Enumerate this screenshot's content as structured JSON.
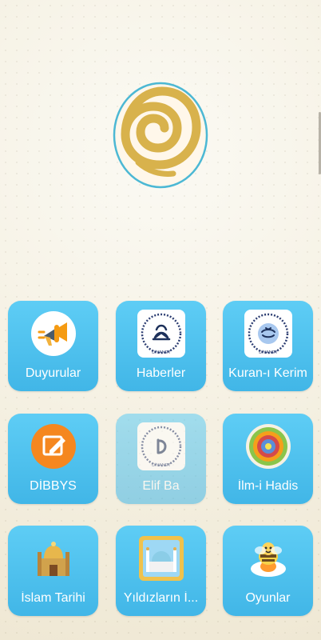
{
  "logo": {
    "name": "app-logo",
    "colors": {
      "ring": "#4cb8d4",
      "gold": "#d8b24c"
    }
  },
  "menu": {
    "tiles": [
      {
        "label": "Duyurular",
        "icon": "megaphone-icon",
        "enabled": true
      },
      {
        "label": "Haberler",
        "icon": "quran-book-icon",
        "enabled": true
      },
      {
        "label": "Kuran-ı Kerim",
        "icon": "quran-seal-icon",
        "enabled": true
      },
      {
        "label": "DİBBYS",
        "icon": "edit-icon",
        "enabled": true
      },
      {
        "label": "Elif Ba",
        "icon": "elif-ba-icon",
        "enabled": false
      },
      {
        "label": "İlm-i Hadis",
        "icon": "mandala-icon",
        "enabled": true
      },
      {
        "label": "İslam Tarihi",
        "icon": "mosque-icon",
        "enabled": true
      },
      {
        "label": "Yıldızların İ...",
        "icon": "mosque-picture-icon",
        "enabled": true
      },
      {
        "label": "Oyunlar",
        "icon": "bee-icon",
        "enabled": true
      }
    ]
  },
  "colors": {
    "tile": "#4bbce9",
    "text": "#ffffff",
    "background": "#f3efe3"
  }
}
